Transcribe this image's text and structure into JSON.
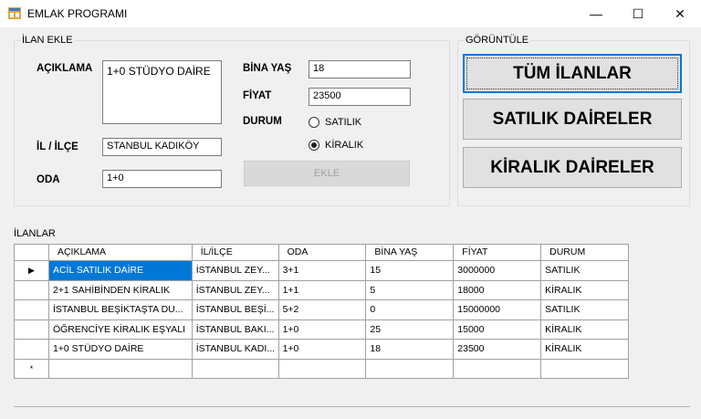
{
  "window": {
    "title": "EMLAK PROGRAMI",
    "minimize": "—",
    "maximize": "☐",
    "close": "✕"
  },
  "ilan_ekle": {
    "group_label": "İLAN EKLE",
    "aciklama_label": "AÇIKLAMA",
    "aciklama_value": "1+0 STÜDYO DAİRE",
    "il_ilce_label": "İL / İLÇE",
    "il_ilce_value": "STANBUL KADIKÖY",
    "oda_label": "ODA",
    "oda_value": "1+0",
    "bina_yas_label": "BİNA YAŞ",
    "bina_yas_value": "18",
    "fiyat_label": "FİYAT",
    "fiyat_value": "23500",
    "durum_label": "DURUM",
    "radio_satilik": "SATILIK",
    "radio_kiralik": "KİRALIK",
    "selected": "KİRALIK",
    "ekle_button": "EKLE"
  },
  "goruntule": {
    "group_label": "GÖRÜNTÜLE",
    "tum_ilanlar": "TÜM İLANLAR",
    "satilik_daireler": "SATILIK DAİRELER",
    "kiralik_daireler": "KİRALIK DAİRELER"
  },
  "ilanlar": {
    "group_label": "İLANLAR",
    "columns": [
      "AÇIKLAMA",
      "İL/İLÇE",
      "ODA",
      "BİNA YAŞ",
      "FİYAT",
      "DURUM"
    ],
    "rows": [
      [
        "ACİL SATILIK DAİRE",
        "İSTANBUL ZEY...",
        "3+1",
        "15",
        "3000000",
        "SATILIK"
      ],
      [
        "2+1 SAHİBİNDEN KİRALIK",
        "İSTANBUL ZEY...",
        "1+1",
        "5",
        "18000",
        "KİRALIK"
      ],
      [
        "İSTANBUL BEŞİKTAŞTA DU...",
        "İSTANBUL BEŞİ...",
        "5+2",
        "0",
        "15000000",
        "SATILIK"
      ],
      [
        "ÖĞRENCİYE KİRALIK EŞYALI",
        "İSTANBUL BAKI...",
        "1+0",
        "25",
        "15000",
        "KİRALIK"
      ],
      [
        "1+0 STÜDYO DAİRE",
        "İSTANBUL KADI...",
        "1+0",
        "18",
        "23500",
        "KİRALIK"
      ]
    ],
    "current_row_marker": "▶",
    "new_row_marker": "*",
    "selected_cell_color": "#0078d7"
  }
}
